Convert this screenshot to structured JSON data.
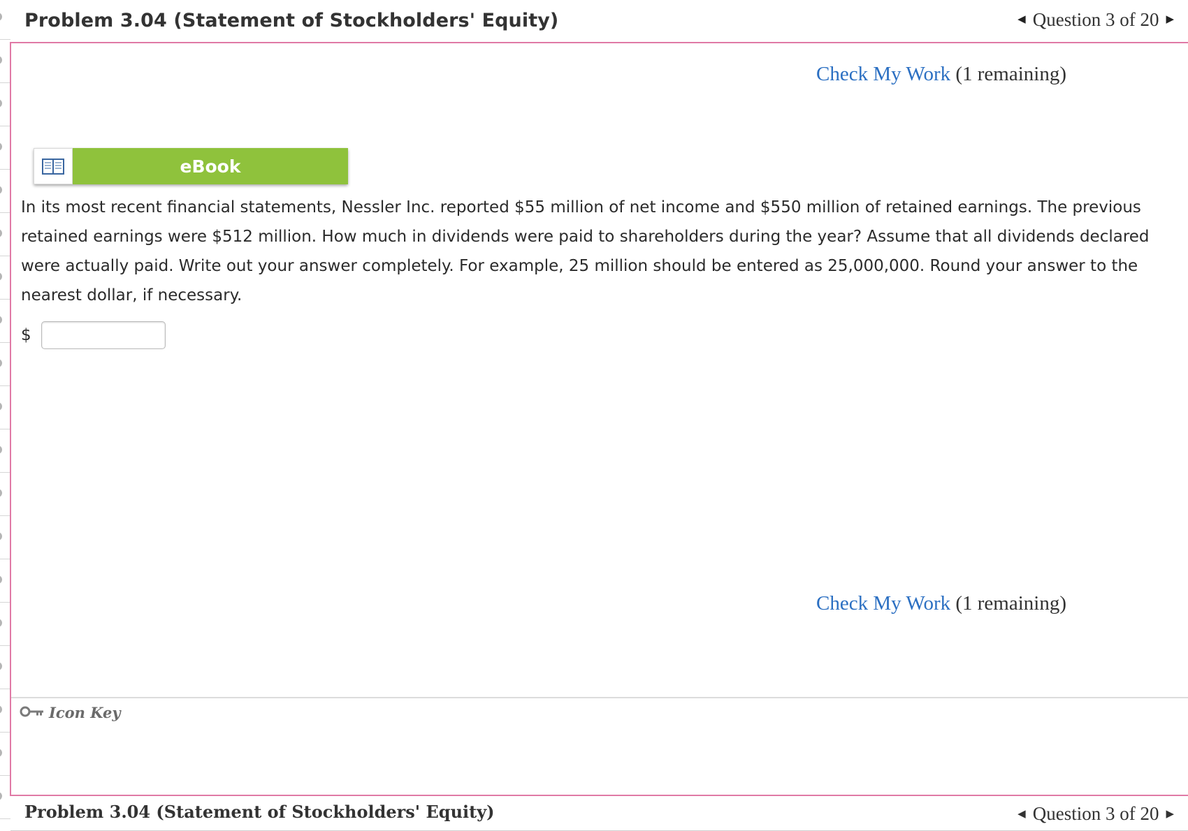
{
  "header": {
    "title": "Problem 3.04 (Statement of Stockholders' Equity)",
    "question_nav": "Question 3 of 20",
    "prev_icon": "triangle-left-icon",
    "next_icon": "triangle-right-icon"
  },
  "check_top": {
    "link": "Check My Work",
    "remaining": "(1 remaining)"
  },
  "ebook": {
    "icon": "book-icon",
    "label": "eBook"
  },
  "question": {
    "text": "In its most recent financial statements, Nessler Inc. reported $55 million of net income and $550 million of retained earnings. The previous retained earnings were $512 million. How much in dividends were paid to shareholders during the year? Assume that all dividends declared were actually paid. Write out your answer completely. For example, 25 million should be entered as 25,000,000. Round your answer to the nearest dollar, if necessary."
  },
  "answer": {
    "currency": "$",
    "value": ""
  },
  "check_bottom": {
    "link": "Check My Work",
    "remaining": "(1 remaining)"
  },
  "icon_key": {
    "icon": "key-icon",
    "label": "Icon Key"
  },
  "footer": {
    "title": "Problem 3.04 (Statement of Stockholders' Equity)",
    "question_nav": "Question 3 of 20"
  },
  "colors": {
    "accent_border": "#e07aa6",
    "link": "#2b6fc2",
    "ebook_green": "#8fc23c"
  }
}
